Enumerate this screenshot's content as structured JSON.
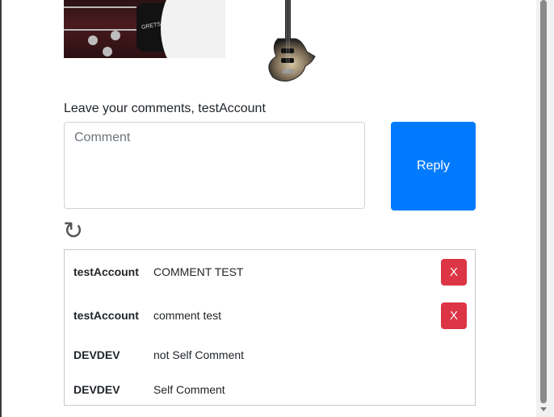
{
  "images": {
    "left_alt": "Electric guitar close-up",
    "left_brand": "GRETSCH",
    "right_alt": "Bass guitar"
  },
  "comment_form": {
    "prompt_prefix": "Leave your comments, ",
    "username": "testAccount",
    "placeholder": "Comment",
    "value": "",
    "reply_label": "Reply",
    "refresh_icon": "↻"
  },
  "comments": [
    {
      "user": "testAccount",
      "text": "COMMENT TEST",
      "deletable": true,
      "delete_label": "X"
    },
    {
      "user": "testAccount",
      "text": "comment test",
      "deletable": true,
      "delete_label": "X"
    },
    {
      "user": "DEVDEV",
      "text": "not Self Comment",
      "deletable": false
    },
    {
      "user": "DEVDEV",
      "text": "Self Comment",
      "deletable": false
    }
  ],
  "colors": {
    "primary": "#007bff",
    "danger": "#dc3545",
    "border": "#ced4da"
  }
}
